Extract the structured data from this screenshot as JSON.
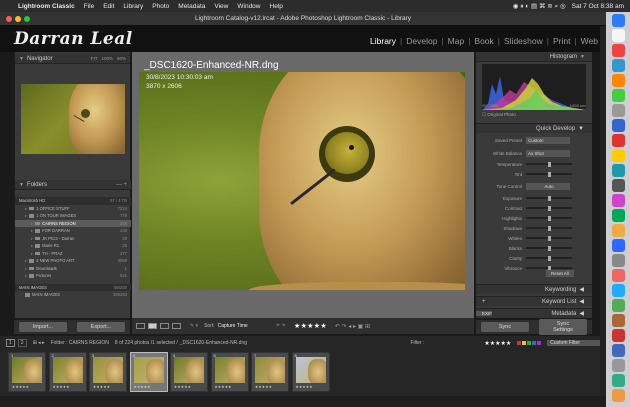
{
  "menubar": {
    "app": "Lightroom Classic",
    "items": [
      "File",
      "Edit",
      "Library",
      "Photo",
      "Metadata",
      "View",
      "Window",
      "Help"
    ],
    "datetime": "Sat 7 Oct 8:38 am"
  },
  "window": {
    "title": "Lightroom Catalog-v12.lrcat - Adobe Photoshop Lightroom Classic - Library"
  },
  "identity_plate": "Darran Leal",
  "modules": [
    {
      "label": "Library",
      "active": true
    },
    {
      "label": "Develop",
      "active": false
    },
    {
      "label": "Map",
      "active": false
    },
    {
      "label": "Book",
      "active": false
    },
    {
      "label": "Slideshow",
      "active": false
    },
    {
      "label": "Print",
      "active": false
    },
    {
      "label": "Web",
      "active": false
    }
  ],
  "navigator": {
    "title": "Navigator",
    "zoom": [
      "FIT",
      "100%",
      "50%"
    ]
  },
  "folders": {
    "title": "Folders",
    "volume": {
      "name": "Macintosh HD",
      "size": "57 / 4 TB"
    },
    "items": [
      {
        "name": "1 OFFICE STUFF",
        "count": "7224",
        "sel": false,
        "indent": 1
      },
      {
        "name": "1 ON TOUR IMAGES",
        "count": "779",
        "sel": false,
        "indent": 1
      },
      {
        "name": "CAIRNS REGION",
        "count": "224",
        "sel": true,
        "indent": 2
      },
      {
        "name": "FOR DARRAN",
        "count": "238",
        "sel": false,
        "indent": 2
      },
      {
        "name": "JK PICS - Darran",
        "count": "28",
        "sel": false,
        "indent": 2
      },
      {
        "name": "Marie R1",
        "count": "26",
        "sel": false,
        "indent": 2
      },
      {
        "name": "TH - PRAZ",
        "count": "277",
        "sel": false,
        "indent": 2
      },
      {
        "name": "2 NEW PHOTO ART",
        "count": "4069",
        "sel": false,
        "indent": 1
      },
      {
        "name": "Downloads",
        "count": "1",
        "sel": false,
        "indent": 1
      },
      {
        "name": "Pictures",
        "count": "931",
        "sel": false,
        "indent": 1
      }
    ],
    "volume2": {
      "name": "MAIN IMAGES",
      "size": "55/200"
    },
    "sub2": {
      "name": "MAIN IMAGES",
      "count": "369293"
    }
  },
  "left_buttons": {
    "import": "Import...",
    "export": "Export..."
  },
  "loupe": {
    "filename": "_DSC1620-Enhanced-NR.dng",
    "date": "30/8/2023 10:30:03 am",
    "dims": "3870 x 2606"
  },
  "toolbar": {
    "sort_label": "Sort:",
    "sort_value": "Capture Time",
    "rating": "★★★★★"
  },
  "histogram": {
    "title": "Histogram",
    "iso": "ISO 2500",
    "focal": "400 mm",
    "aperture": "f/5.6",
    "shutter": "1/800 sec",
    "original_photo": "Original Photo"
  },
  "quick_develop": {
    "title": "Quick Develop",
    "saved_preset_label": "Saved Preset",
    "saved_preset": "Custom",
    "white_balance_label": "White Balance",
    "white_balance": "As Shot",
    "temperature": "Temperature",
    "tint": "Tint",
    "tone_control": "Tone Control",
    "auto": "Auto",
    "rows": [
      "Exposure",
      "Contrast",
      "Highlights",
      "Shadows",
      "Whites",
      "Blacks",
      "Clarity",
      "Vibrance"
    ],
    "reset": "Reset All"
  },
  "right_sections": {
    "keywording": "Keywording",
    "keyword_list": "Keyword List",
    "metadata": "Metadata",
    "metadata_preset": "EXIF"
  },
  "right_buttons": {
    "sync": "Sync",
    "sync_settings": "Sync Settings"
  },
  "filmstrip_bar": {
    "pages": [
      "1",
      "2"
    ],
    "folder": "Folder : CAIRNS REGION",
    "count": "8 of 224 photos /1 selected /",
    "file": "_DSC1620-Enhanced-NR.dng",
    "filter_label": "Filter :",
    "filter_rating": "★★★★★",
    "custom_filter": "Custom Filter"
  },
  "filmstrip": [
    {
      "num": "1",
      "stars": "★★★★★",
      "sel": false
    },
    {
      "num": "2",
      "stars": "★★★★★",
      "sel": false
    },
    {
      "num": "3",
      "stars": "★★★★★",
      "sel": false
    },
    {
      "num": "4",
      "stars": "★★★★★",
      "sel": true
    },
    {
      "num": "5",
      "stars": "★★★★★",
      "sel": false
    },
    {
      "num": "6",
      "stars": "★★★★★",
      "sel": false
    },
    {
      "num": "7",
      "stars": "★★★★★",
      "sel": false
    },
    {
      "num": "8",
      "stars": "★★★★★",
      "sel": false
    }
  ],
  "colors": {
    "accent": "#ffffff",
    "panel": "#3a3a3a",
    "selected": "#5b5b5b"
  }
}
